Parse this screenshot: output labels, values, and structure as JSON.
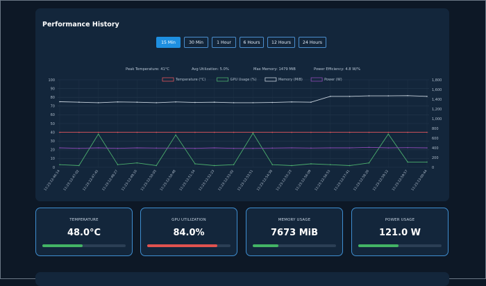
{
  "panel": {
    "title": "Performance History",
    "ranges": [
      {
        "label": "15 Min",
        "active": true
      },
      {
        "label": "30 Min",
        "active": false
      },
      {
        "label": "1 Hour",
        "active": false
      },
      {
        "label": "6 Hours",
        "active": false
      },
      {
        "label": "12 Hours",
        "active": false
      },
      {
        "label": "24 Hours",
        "active": false
      }
    ],
    "stats": {
      "peak_temp": "Peak Temperature: 41°C",
      "avg_util": "Avg Utilization: 5.0%",
      "max_mem": "Max Memory: 1479 MiB",
      "efficiency": "Power Efficiency: 4.8 W/%"
    }
  },
  "chart_data": {
    "type": "line",
    "title": "",
    "y_left_ticks": [
      "0",
      "10",
      "20",
      "30",
      "40",
      "50",
      "60",
      "70",
      "80",
      "90",
      "100"
    ],
    "y_right_ticks": [
      "0",
      "200",
      "400",
      "600",
      "800",
      "1,000",
      "1,200",
      "1,400",
      "1,600",
      "1,800"
    ],
    "ylim_left": [
      0,
      100
    ],
    "ylim_right": [
      0,
      1800
    ],
    "x_labels": [
      "11:23:12:46:14",
      "11:23:12:47:02",
      "11:23:12:47:45",
      "11:23:12:48:27",
      "11:23:12:49:16",
      "11:23:12:50:03",
      "11:23:12:50:48",
      "11:23:12:51:34",
      "11:23:12:52:23",
      "11:23:12:53:02",
      "11:23:12:53:51",
      "11:23:12:54:38",
      "11:23:12:55:23",
      "11:23:12:56:09",
      "11:23:12:56:55",
      "11:23:12:57:41",
      "11:23:12:58:26",
      "11:23:12:59:12",
      "11:23:12:59:57",
      "11:23:13:00:44"
    ],
    "grid": true,
    "legend_position": "top",
    "series": [
      {
        "name": "Temperature (°C)",
        "color": "#e2545c",
        "axis": "left",
        "values": [
          40,
          40,
          40,
          40,
          40,
          40,
          40,
          40,
          40,
          40,
          40,
          40,
          40,
          40,
          40,
          40,
          40,
          40,
          40,
          40
        ]
      },
      {
        "name": "GPU Usage (%)",
        "color": "#4caf6e",
        "axis": "left",
        "values": [
          3,
          2,
          38,
          3,
          5,
          2,
          37,
          4,
          2,
          3,
          39,
          3,
          2,
          4,
          3,
          2,
          5,
          38,
          6,
          6
        ]
      },
      {
        "name": "Memory (MiB)",
        "color": "#c8d3de",
        "axis": "right",
        "values": [
          1350,
          1340,
          1330,
          1345,
          1340,
          1330,
          1345,
          1335,
          1340,
          1330,
          1330,
          1335,
          1345,
          1340,
          1460,
          1460,
          1470,
          1470,
          1475,
          1460
        ]
      },
      {
        "name": "Power (W)",
        "color": "#8e4bb8",
        "axis": "right",
        "values": [
          400,
          390,
          400,
          390,
          400,
          395,
          395,
          390,
          400,
          390,
          390,
          395,
          400,
          395,
          400,
          400,
          410,
          400,
          405,
          400
        ]
      }
    ]
  },
  "cards": [
    {
      "label": "TEMPERATURE",
      "value": "48.0°C",
      "fill_pct": 48,
      "color": "#43b465"
    },
    {
      "label": "GPU UTILIZATION",
      "value": "84.0%",
      "fill_pct": 84,
      "color": "#e0524f"
    },
    {
      "label": "MEMORY USAGE",
      "value": "7673 MiB",
      "fill_pct": 31,
      "color": "#43b465"
    },
    {
      "label": "POWER USAGE",
      "value": "121.0 W",
      "fill_pct": 48,
      "color": "#43b465"
    }
  ]
}
